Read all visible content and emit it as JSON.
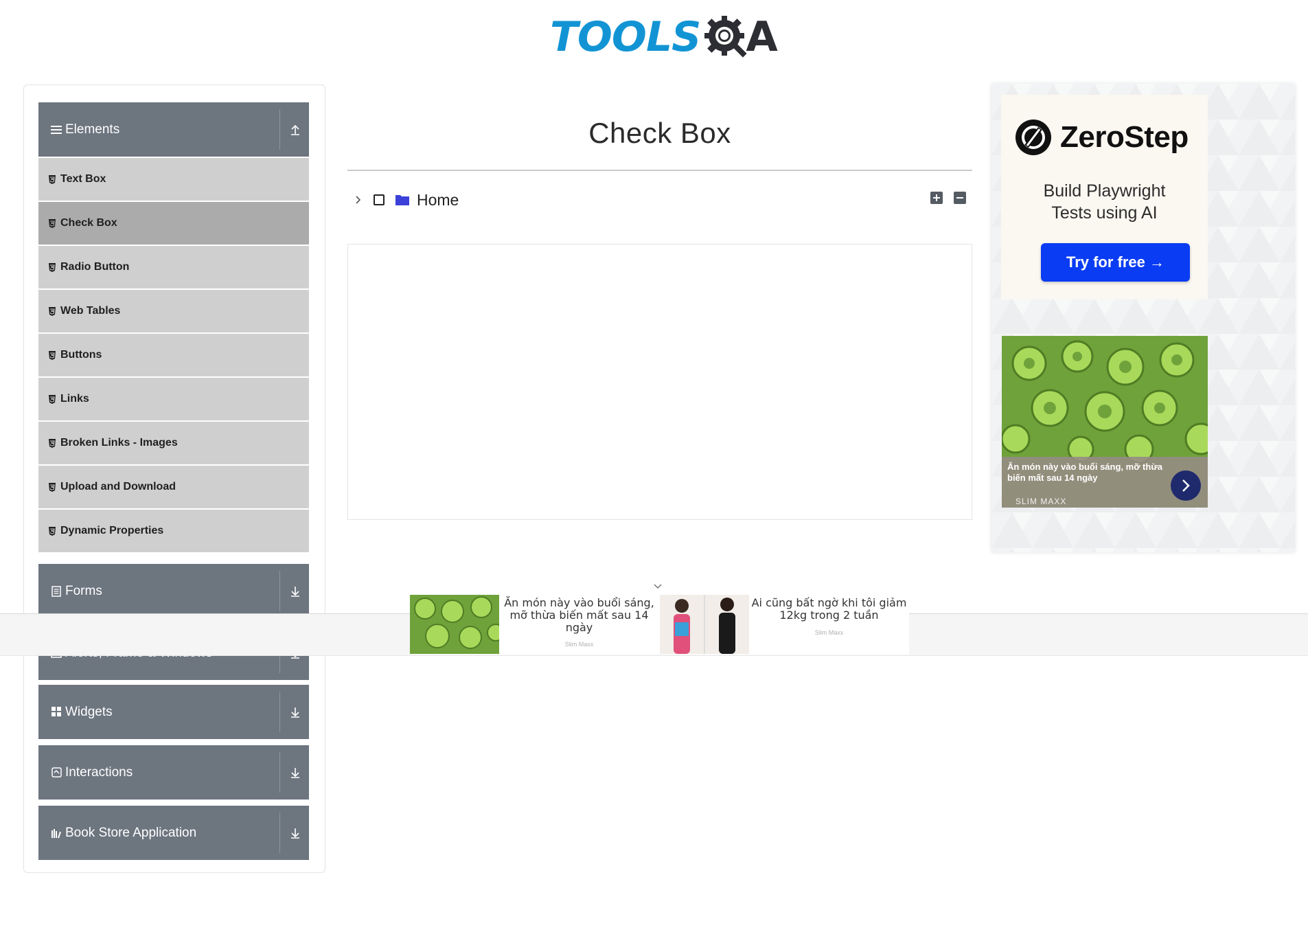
{
  "logo": {
    "part1": "TOOLS",
    "part2": "A"
  },
  "sidebar": {
    "groups": [
      {
        "title": "Elements",
        "expanded": true,
        "items": [
          "Text Box",
          "Check Box",
          "Radio Button",
          "Web Tables",
          "Buttons",
          "Links",
          "Broken Links - Images",
          "Upload and Download",
          "Dynamic Properties"
        ],
        "active_item": "Check Box"
      },
      {
        "title": "Forms",
        "expanded": false
      },
      {
        "title": "Alerts, Frame & Windows",
        "expanded": false
      },
      {
        "title": "Widgets",
        "expanded": false
      },
      {
        "title": "Interactions",
        "expanded": false
      },
      {
        "title": "Book Store Application",
        "expanded": false
      }
    ]
  },
  "main": {
    "title": "Check Box",
    "tree": {
      "root_label": "Home",
      "checked": false,
      "expanded": false
    }
  },
  "right_ad": {
    "brand": "ZeroStep",
    "tagline_line1": "Build Playwright",
    "tagline_line2": "Tests using AI",
    "cta": "Try for free →",
    "food_caption": "Ăn món này vào buổi sáng, mỡ thừa biến mất sau 14 ngày",
    "food_brand": "SLIM MAXX"
  },
  "bottom_ads": [
    {
      "text": "Ăn món này vào buổi sáng, mỡ thừa biến mất sau 14 ngày",
      "source": "Slim Maxx"
    },
    {
      "text": "Ai cũng bất ngờ khi tôi giảm 12kg trong 2 tuần",
      "source": "Slim Maxx"
    }
  ],
  "colors": {
    "accent": "#1294d4",
    "sidebar_header": "#6d757f",
    "menu_item": "#cfcfcf",
    "menu_active": "#ababab",
    "cta": "#0a3cf3"
  },
  "icons": {
    "group_icons": [
      "hamburger-icon",
      "form-icon",
      "window-icon",
      "grid-icon",
      "interaction-icon",
      "bookstore-icon"
    ],
    "item_icon": "html5-icon"
  }
}
